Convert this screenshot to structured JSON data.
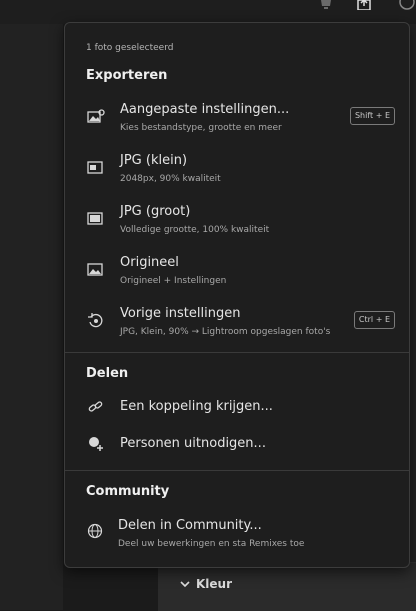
{
  "background": {
    "kleur_label": "Kleur"
  },
  "menu": {
    "selected_count": "1 foto geselecteerd",
    "sections": {
      "exporteren": "Exporteren",
      "delen": "Delen",
      "community": "Community"
    },
    "export_items": [
      {
        "label": "Aangepaste instellingen...",
        "sub": "Kies bestandstype, grootte en meer",
        "shortcut": "Shift + E",
        "icon": "custom-settings-icon"
      },
      {
        "label": "JPG (klein)",
        "sub": "2048px, 90% kwaliteit",
        "icon": "jpg-small-icon"
      },
      {
        "label": "JPG (groot)",
        "sub": "Volledige grootte, 100% kwaliteit",
        "icon": "jpg-large-icon"
      },
      {
        "label": "Origineel",
        "sub": "Origineel + Instellingen",
        "icon": "original-image-icon"
      },
      {
        "label": "Vorige instellingen",
        "sub": "JPG, Klein, 90% → Lightroom opgeslagen foto's",
        "shortcut": "Ctrl + E",
        "icon": "previous-settings-icon"
      }
    ],
    "share_items": [
      {
        "label": "Een koppeling krijgen...",
        "icon": "link-icon"
      },
      {
        "label": "Personen uitnodigen...",
        "icon": "invite-person-icon"
      }
    ],
    "community_items": [
      {
        "label": "Delen in Community...",
        "sub": "Deel uw bewerkingen en sta Remixes toe",
        "icon": "globe-icon"
      }
    ]
  },
  "colors": {
    "menu_bg": "#1e1e1e",
    "app_bg": "#1b1b1b",
    "text": "#e6e6e6",
    "subtext": "#a8a8a8"
  }
}
